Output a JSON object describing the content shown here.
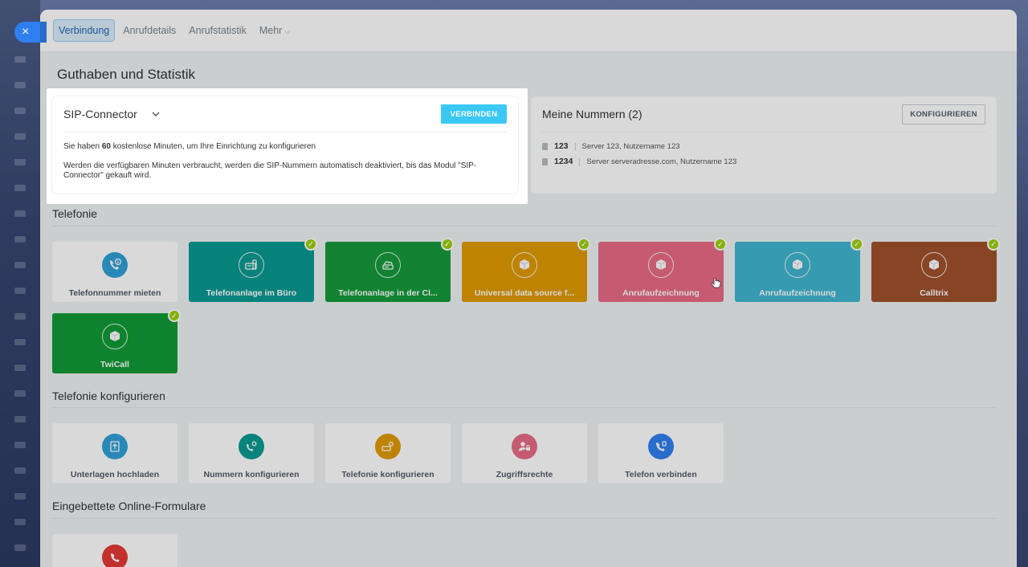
{
  "close_label": "×",
  "nav": {
    "tabs": [
      {
        "label": "Verbindung",
        "active": true
      },
      {
        "label": "Anrufdetails",
        "active": false
      },
      {
        "label": "Anrufstatistik",
        "active": false
      },
      {
        "label": "Mehr",
        "active": false
      }
    ]
  },
  "page_title": "Guthaben und Statistik",
  "sip_card": {
    "title": "SIP-Connector",
    "button": "VERBINDEN",
    "line1_prefix": "Sie haben ",
    "line1_minutes": "60",
    "line1_suffix": " kostenlose Minuten, um Ihre Einrichtung zu konfigurieren",
    "line2": "Werden die verfügbaren Minuten verbraucht, werden die SIP-Nummern automatisch deaktiviert, bis das Modul \"SIP-Connector\" gekauft wird."
  },
  "numbers_card": {
    "title": "Meine Nummern (2)",
    "button": "KONFIGURIEREN",
    "items": [
      {
        "number": "123",
        "detail": "Server 123, Nutzername 123"
      },
      {
        "number": "1234",
        "detail": "Server serveradresse.com, Nutzername 123"
      }
    ]
  },
  "sections": {
    "telefonie": "Telefonie",
    "konfig": "Telefonie konfigurieren",
    "forms": "Eingebettete Online-Formulare"
  },
  "telefonie_tiles": [
    {
      "label": "Telefonnummer mieten",
      "icon": "phone-dollar-icon",
      "color": "#ffffff",
      "icon_color": "#2fa1d8",
      "checked": false
    },
    {
      "label": "Telefonanlage im Büro",
      "icon": "pbx-icon",
      "color": "#0a9a92",
      "checked": true
    },
    {
      "label": "Telefonanlage in der Cl...",
      "icon": "cloud-pbx-icon",
      "color": "#159a3b",
      "checked": true
    },
    {
      "label": "Universal data source f...",
      "icon": "box-icon",
      "color": "#e09a00",
      "checked": true
    },
    {
      "label": "Anrufaufzeichnung",
      "icon": "box-icon",
      "color": "#e86a84",
      "checked": true
    },
    {
      "label": "Anrufaufzeichnung",
      "icon": "box-icon",
      "color": "#40b5cf",
      "checked": true
    },
    {
      "label": "Calltrix",
      "icon": "box-icon",
      "color": "#a0522d",
      "checked": true
    },
    {
      "label": "TwiCall",
      "icon": "box-icon",
      "color": "#119a36",
      "checked": true
    }
  ],
  "konfig_tiles": [
    {
      "label": "Unterlagen hochladen",
      "icon": "upload-doc-icon",
      "icon_color": "#2fa1d8"
    },
    {
      "label": "Nummern konfigurieren",
      "icon": "phone-gear-icon",
      "icon_color": "#0a9a92"
    },
    {
      "label": "Telefonie konfigurieren",
      "icon": "pbx-gear-icon",
      "icon_color": "#e09a00"
    },
    {
      "label": "Zugriffsrechte",
      "icon": "user-lock-icon",
      "icon_color": "#e86a84"
    },
    {
      "label": "Telefon verbinden",
      "icon": "phone-plug-icon",
      "icon_color": "#2f7ff0"
    }
  ],
  "forms_tiles": [
    {
      "label": "",
      "icon": "phone-call-icon",
      "icon_color": "#e53935"
    }
  ],
  "checkmark": "✓"
}
